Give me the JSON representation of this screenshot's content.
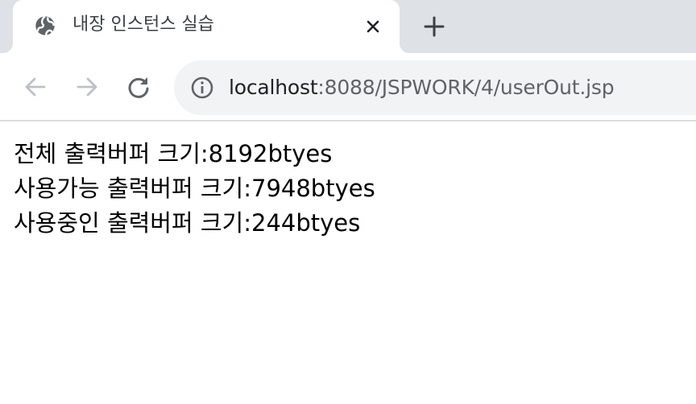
{
  "tab": {
    "title": "내장 인스턴스 실습",
    "favicon": "globe-icon",
    "close_icon": "close-icon"
  },
  "new_tab_icon": "plus-icon",
  "toolbar": {
    "back_icon": "arrow-left-icon",
    "forward_icon": "arrow-right-icon",
    "reload_icon": "reload-icon",
    "site_info_icon": "info-icon"
  },
  "address_bar": {
    "host": "localhost",
    "path": ":8088/JSPWORK/4/userOut.jsp"
  },
  "content": {
    "lines": [
      "전체 출력버퍼 크기:8192btyes",
      "사용가능 출력버퍼 크기:7948btyes",
      "사용중인 출력버퍼 크기:244btyes"
    ]
  },
  "colors": {
    "tabstrip_bg": "#dee1e6",
    "omnibox_bg": "#f1f3f4",
    "icon_active": "#5f6368",
    "icon_disabled": "#bdc1c6"
  }
}
